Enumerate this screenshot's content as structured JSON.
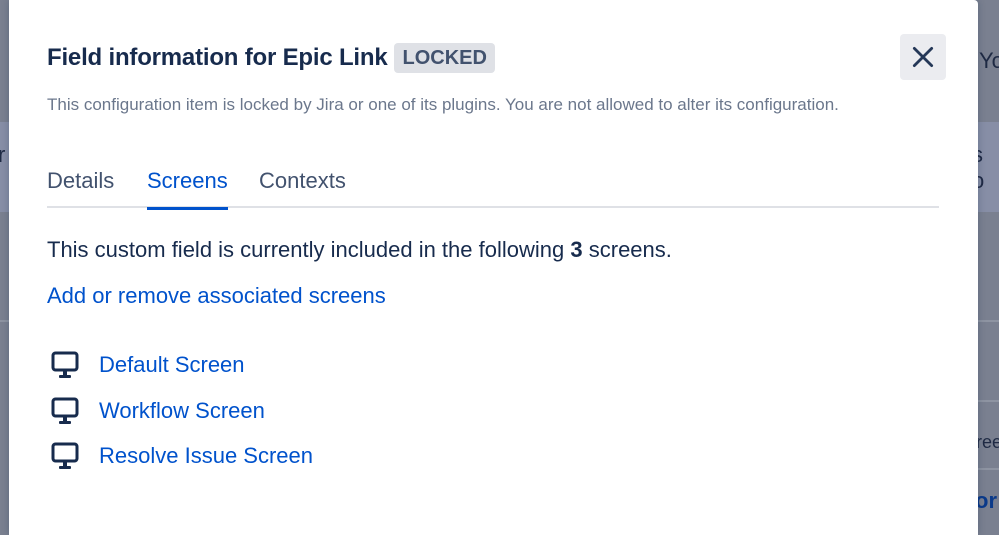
{
  "dialog": {
    "title": "Field information for Epic Link",
    "badge": "LOCKED",
    "description": "This configuration item is locked by Jira or one of its plugins. You are not allowed to alter its configuration."
  },
  "tabs": [
    {
      "label": "Details",
      "active": false
    },
    {
      "label": "Screens",
      "active": true
    },
    {
      "label": "Contexts",
      "active": false
    }
  ],
  "screens_panel": {
    "summary_prefix": "This custom field is currently included in the following",
    "count": "3",
    "summary_suffix": "screens.",
    "manage_link": "Add or remove associated screens",
    "items": [
      {
        "label": "Default Screen",
        "icon": "monitor-icon"
      },
      {
        "label": "Workflow Screen",
        "icon": "monitor-icon"
      },
      {
        "label": "Resolve Issue Screen",
        "icon": "monitor-icon"
      }
    ]
  },
  "background": {
    "fragments": [
      "You",
      "r",
      "s o",
      "ree",
      "or"
    ]
  },
  "colors": {
    "accent": "#0052cc",
    "title": "#172b4d",
    "muted": "#6b778c",
    "badge_bg": "#dfe1e6",
    "overlay": "#7a8090"
  }
}
